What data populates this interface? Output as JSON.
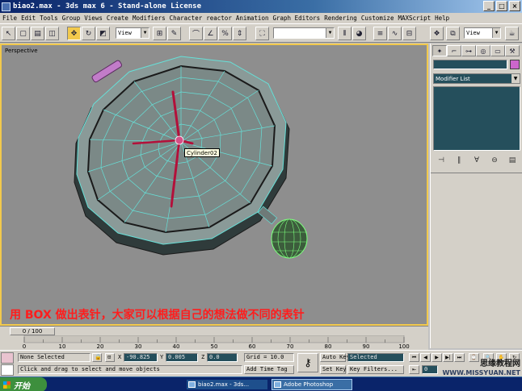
{
  "window": {
    "title": "biao2.max - 3ds max 6 - Stand-alone License"
  },
  "menu": [
    "File",
    "Edit",
    "Tools",
    "Group",
    "Views",
    "Create",
    "Modifiers",
    "Character",
    "reactor",
    "Animation",
    "Graph Editors",
    "Rendering",
    "Customize",
    "MAXScript",
    "Help"
  ],
  "toolbar": {
    "ref_coord": "View",
    "named_sel": "",
    "right_view": "View"
  },
  "viewport": {
    "label": "Perspective",
    "tooltip": "Cylinder02",
    "caption": "用 BOX 做出表针，大家可以根据自己的想法做不同的表针"
  },
  "command_panel": {
    "modifier_list": "Modifier List"
  },
  "timeline": {
    "frame_display": "0 / 100",
    "ticks": [
      "0",
      "10",
      "20",
      "30",
      "40",
      "50",
      "60",
      "70",
      "80",
      "90",
      "100"
    ]
  },
  "status": {
    "selection": "None Selected",
    "prompt": "Click and drag to select and move objects",
    "x_label": "X",
    "x_value": "-90.825",
    "y_label": "Y",
    "y_value": "0.005",
    "z_label": "Z",
    "z_value": "0.0",
    "grid": "Grid = 10.0",
    "add_time_tag": "Add Time Tag",
    "auto_key": "Auto Key",
    "set_key": "Set Key",
    "key_mode": "Selected",
    "key_filters": "Key Filters...",
    "frame": "0"
  },
  "taskbar": {
    "start": "开始",
    "items": [
      "biao2.max - 3ds...",
      "Adobe Photoshop"
    ]
  },
  "watermark": {
    "line1": "思缘教程网",
    "line2": "WWW.MISSYUAN.NET"
  },
  "colors": {
    "selection_yellow": "#f2c94c",
    "wire_cyan": "#66e0d8",
    "hand_red": "#b3103a",
    "knob_green": "#7dff7d",
    "bezel": "#3a4a4a"
  }
}
